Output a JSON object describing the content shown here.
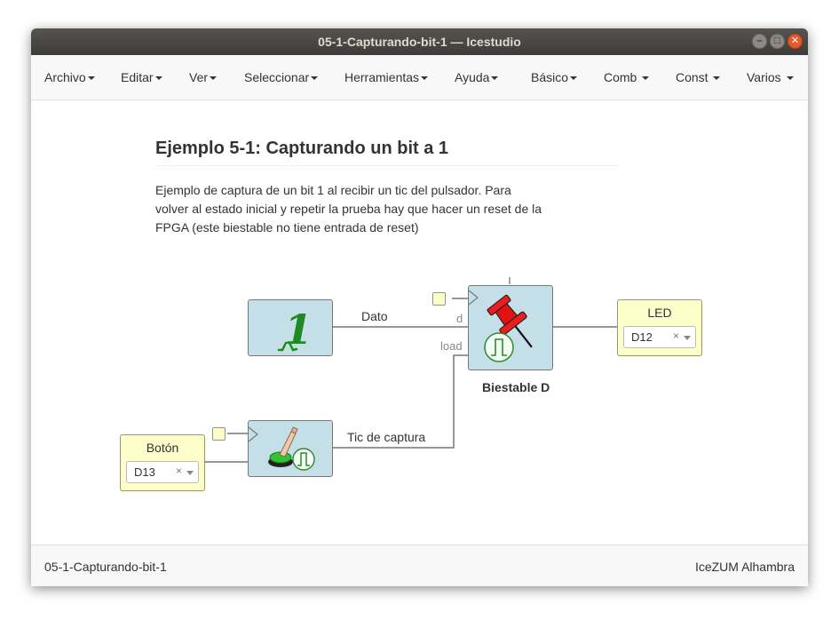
{
  "window": {
    "title": "05-1-Capturando-bit-1 — Icestudio"
  },
  "menu": {
    "items": [
      {
        "label": "Archivo"
      },
      {
        "label": "Editar"
      },
      {
        "label": "Ver"
      },
      {
        "label": "Seleccionar"
      },
      {
        "label": "Herramientas"
      },
      {
        "label": "Ayuda"
      },
      {
        "label": "Básico"
      },
      {
        "label": "Comb"
      },
      {
        "label": "Const"
      },
      {
        "label": "Varios"
      }
    ]
  },
  "info": {
    "title": "Ejemplo 5-1: Capturando un bit a 1",
    "body": "Ejemplo de captura de un bit 1 al recibir un tic del pulsador. Para volver al estado inicial y repetir la prueba hay que hacer un reset de la FPGA (este biestable no tiene entrada de reset)"
  },
  "blocks": {
    "constant": {
      "glyph": "1"
    },
    "dff": {
      "label": "Biestable D",
      "port_d": "d",
      "port_load": "load"
    },
    "led": {
      "name": "LED",
      "pin": "D12",
      "clear": "×"
    },
    "button": {
      "name": "Botón",
      "pin": "D13",
      "clear": "×"
    }
  },
  "wires": {
    "data": "Dato",
    "tick": "Tic de captura"
  },
  "status": {
    "left": "05-1-Capturando-bit-1",
    "right": "IceZUM Alhambra"
  },
  "colors": {
    "block_fill": "#c5dfe8",
    "io_fill": "#fefeca",
    "title_bar": "#3d3c38",
    "close_button": "#e9572d"
  }
}
